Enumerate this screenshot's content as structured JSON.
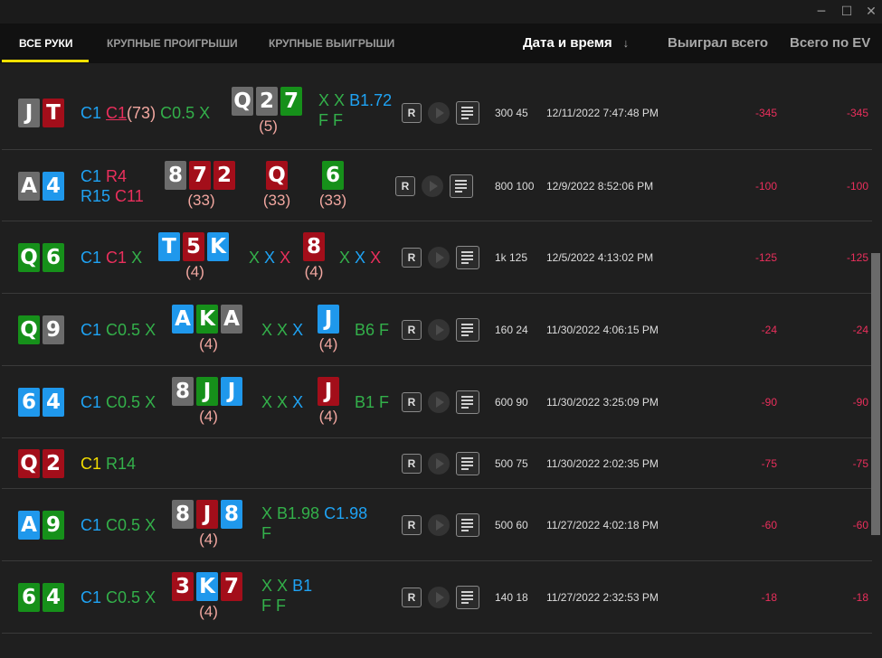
{
  "window": {
    "minimize_icon": "─",
    "maximize_icon": "☐",
    "close_icon": "✕"
  },
  "tabs": [
    {
      "label": "ВСЕ РУКИ",
      "active": true
    },
    {
      "label": "КРУПНЫЕ ПРОИГРЫШИ",
      "active": false
    },
    {
      "label": "КРУПНЫЕ ВЫИГРЫШИ",
      "active": false
    }
  ],
  "columns": {
    "datetime": "Дата и время",
    "sort_arrow": "↓",
    "won_total": "Выиграл всего",
    "total_ev": "Всего по EV"
  },
  "buttons": {
    "replay_label": "R"
  },
  "colors": {
    "accent": "#f5e000",
    "loss": "#ea2f5c"
  },
  "hands": [
    {
      "hole": [
        {
          "r": "J",
          "s": "grey"
        },
        {
          "r": "T",
          "s": "red"
        }
      ],
      "preflop": [
        {
          "t": "C1",
          "c": "blue"
        },
        {
          "t": "C1",
          "c": "under"
        },
        {
          "t": "(73)",
          "c": "pink"
        },
        {
          "t": "C0.5",
          "c": "green"
        },
        {
          "t": "X",
          "c": "green"
        }
      ],
      "flop": [
        {
          "r": "Q",
          "s": "grey"
        },
        {
          "r": "2",
          "s": "grey"
        },
        {
          "r": "7",
          "s": "green"
        }
      ],
      "flop_count": "(5)",
      "flop_actions": [
        [
          {
            "t": "X",
            "c": "green"
          },
          {
            "t": "X",
            "c": "green"
          },
          {
            "t": "B1.72",
            "c": "blue"
          }
        ],
        [
          {
            "t": "F",
            "c": "green"
          },
          {
            "t": "F",
            "c": "green"
          }
        ]
      ],
      "stakes": "300 45",
      "date": "12/11/2022 7:47:48 PM",
      "won": "-345",
      "ev": "-345"
    },
    {
      "hole": [
        {
          "r": "A",
          "s": "grey"
        },
        {
          "r": "4",
          "s": "blue"
        }
      ],
      "preflop_lines": [
        [
          {
            "t": "C1",
            "c": "blue"
          },
          {
            "t": "R4",
            "c": "red"
          }
        ],
        [
          {
            "t": "R15",
            "c": "blue"
          },
          {
            "t": "C11",
            "c": "red"
          }
        ]
      ],
      "flop": [
        {
          "r": "8",
          "s": "grey"
        },
        {
          "r": "7",
          "s": "red"
        },
        {
          "r": "2",
          "s": "red"
        }
      ],
      "flop_count": "(33)",
      "turn": [
        {
          "r": "Q",
          "s": "red"
        }
      ],
      "turn_count": "(33)",
      "river": [
        {
          "r": "6",
          "s": "green"
        }
      ],
      "river_count": "(33)",
      "stakes": "800 100",
      "date": "12/9/2022 8:52:06 PM",
      "won": "-100",
      "ev": "-100"
    },
    {
      "hole": [
        {
          "r": "Q",
          "s": "green"
        },
        {
          "r": "6",
          "s": "green"
        }
      ],
      "preflop": [
        {
          "t": "C1",
          "c": "blue"
        },
        {
          "t": "C1",
          "c": "red"
        },
        {
          "t": "X",
          "c": "green"
        }
      ],
      "flop": [
        {
          "r": "T",
          "s": "blue"
        },
        {
          "r": "5",
          "s": "red"
        },
        {
          "r": "K",
          "s": "blue"
        }
      ],
      "flop_count": "(4)",
      "flop_actions": [
        [
          {
            "t": "X",
            "c": "green"
          },
          {
            "t": "X",
            "c": "blue"
          },
          {
            "t": "X",
            "c": "red"
          }
        ]
      ],
      "turn": [
        {
          "r": "8",
          "s": "red"
        }
      ],
      "turn_count": "(4)",
      "turn_actions": [
        {
          "t": "X",
          "c": "green"
        },
        {
          "t": "X",
          "c": "blue"
        },
        {
          "t": "X",
          "c": "red"
        }
      ],
      "stakes": "1k 125",
      "date": "12/5/2022 4:13:02 PM",
      "won": "-125",
      "ev": "-125"
    },
    {
      "hole": [
        {
          "r": "Q",
          "s": "green"
        },
        {
          "r": "9",
          "s": "grey"
        }
      ],
      "preflop": [
        {
          "t": "C1",
          "c": "blue"
        },
        {
          "t": "C0.5",
          "c": "green"
        },
        {
          "t": "X",
          "c": "green"
        }
      ],
      "flop": [
        {
          "r": "A",
          "s": "blue"
        },
        {
          "r": "K",
          "s": "green"
        },
        {
          "r": "A",
          "s": "grey"
        }
      ],
      "flop_count": "(4)",
      "flop_actions": [
        [
          {
            "t": "X",
            "c": "green"
          },
          {
            "t": "X",
            "c": "green"
          },
          {
            "t": "X",
            "c": "blue"
          }
        ]
      ],
      "turn": [
        {
          "r": "J",
          "s": "blue"
        }
      ],
      "turn_count": "(4)",
      "turn_actions": [
        {
          "t": "B6",
          "c": "green"
        },
        {
          "t": "F",
          "c": "green"
        }
      ],
      "stakes": "160 24",
      "date": "11/30/2022 4:06:15 PM",
      "won": "-24",
      "ev": "-24"
    },
    {
      "hole": [
        {
          "r": "6",
          "s": "blue"
        },
        {
          "r": "4",
          "s": "blue"
        }
      ],
      "preflop": [
        {
          "t": "C1",
          "c": "blue"
        },
        {
          "t": "C0.5",
          "c": "green"
        },
        {
          "t": "X",
          "c": "green"
        }
      ],
      "flop": [
        {
          "r": "8",
          "s": "grey"
        },
        {
          "r": "J",
          "s": "green"
        },
        {
          "r": "J",
          "s": "blue"
        }
      ],
      "flop_count": "(4)",
      "flop_actions": [
        [
          {
            "t": "X",
            "c": "green"
          },
          {
            "t": "X",
            "c": "green"
          },
          {
            "t": "X",
            "c": "blue"
          }
        ]
      ],
      "turn": [
        {
          "r": "J",
          "s": "red"
        }
      ],
      "turn_count": "(4)",
      "turn_actions": [
        {
          "t": "B1",
          "c": "green"
        },
        {
          "t": "F",
          "c": "green"
        }
      ],
      "stakes": "600 90",
      "date": "11/30/2022 3:25:09 PM",
      "won": "-90",
      "ev": "-90"
    },
    {
      "hole": [
        {
          "r": "Q",
          "s": "red"
        },
        {
          "r": "2",
          "s": "red"
        }
      ],
      "preflop": [
        {
          "t": "C1",
          "c": "yellow"
        },
        {
          "t": "R14",
          "c": "green"
        }
      ],
      "stakes": "500 75",
      "date": "11/30/2022 2:02:35 PM",
      "won": "-75",
      "ev": "-75"
    },
    {
      "hole": [
        {
          "r": "A",
          "s": "blue"
        },
        {
          "r": "9",
          "s": "green"
        }
      ],
      "preflop": [
        {
          "t": "C1",
          "c": "blue"
        },
        {
          "t": "C0.5",
          "c": "green"
        },
        {
          "t": "X",
          "c": "green"
        }
      ],
      "flop": [
        {
          "r": "8",
          "s": "grey"
        },
        {
          "r": "J",
          "s": "red"
        },
        {
          "r": "8",
          "s": "blue"
        }
      ],
      "flop_count": "(4)",
      "flop_actions": [
        [
          {
            "t": "X",
            "c": "green"
          },
          {
            "t": "B1.98",
            "c": "green"
          },
          {
            "t": "C1.98",
            "c": "blue"
          }
        ],
        [
          {
            "t": "F",
            "c": "green"
          }
        ]
      ],
      "stakes": "500 60",
      "date": "11/27/2022 4:02:18 PM",
      "won": "-60",
      "ev": "-60"
    },
    {
      "hole": [
        {
          "r": "6",
          "s": "green"
        },
        {
          "r": "4",
          "s": "green"
        }
      ],
      "preflop": [
        {
          "t": "C1",
          "c": "blue"
        },
        {
          "t": "C0.5",
          "c": "green"
        },
        {
          "t": "X",
          "c": "green"
        }
      ],
      "flop": [
        {
          "r": "3",
          "s": "red"
        },
        {
          "r": "K",
          "s": "blue"
        },
        {
          "r": "7",
          "s": "red"
        }
      ],
      "flop_count": "(4)",
      "flop_actions": [
        [
          {
            "t": "X",
            "c": "green"
          },
          {
            "t": "X",
            "c": "green"
          },
          {
            "t": "B1",
            "c": "blue"
          }
        ],
        [
          {
            "t": "F",
            "c": "green"
          },
          {
            "t": "F",
            "c": "green"
          }
        ]
      ],
      "stakes": "140 18",
      "date": "11/27/2022 2:32:53 PM",
      "won": "-18",
      "ev": "-18"
    }
  ]
}
